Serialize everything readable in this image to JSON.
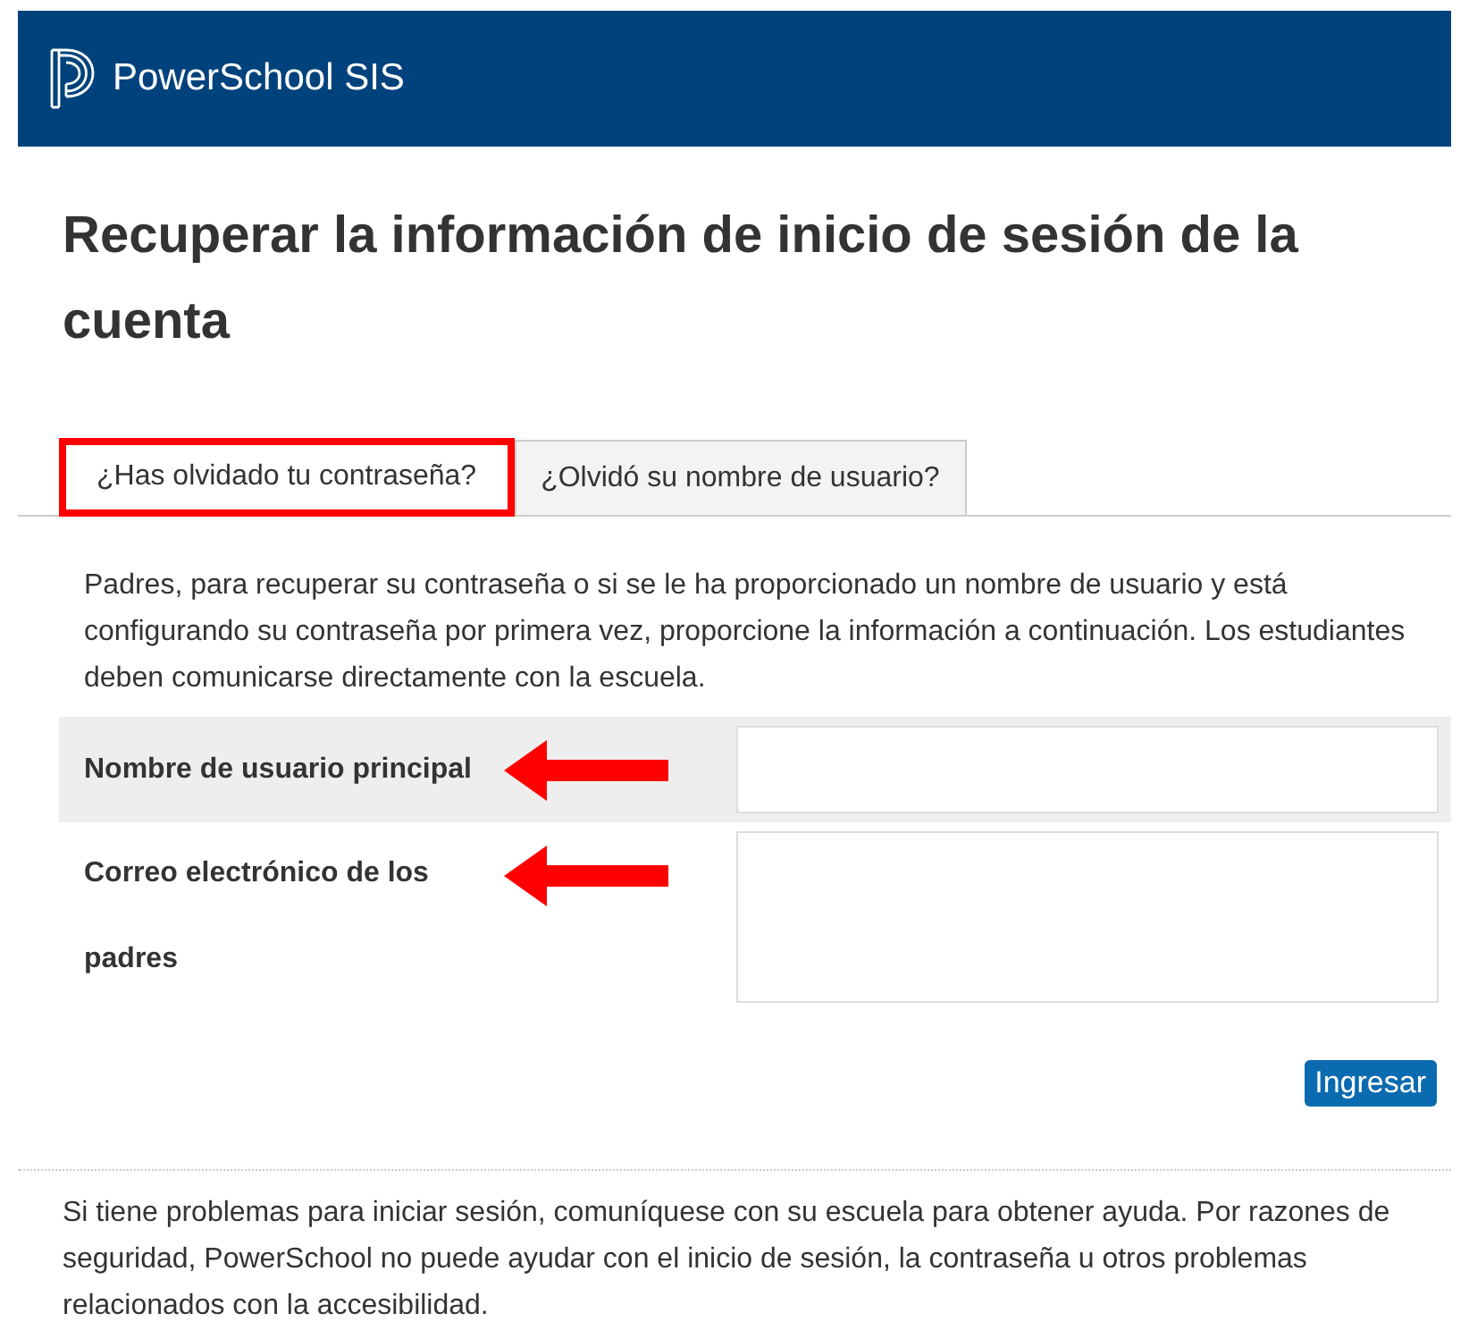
{
  "header": {
    "brand": "PowerSchool SIS"
  },
  "title": "Recuperar la información de inicio de sesión de la cuenta",
  "tabs": [
    {
      "label": "¿Has olvidado tu contraseña?",
      "selected": true,
      "highlighted": true
    },
    {
      "label": "¿Olvidó su nombre de usuario?",
      "selected": false,
      "highlighted": false
    }
  ],
  "intro": "Padres, para recuperar su contraseña o si se le ha proporcionado un nombre de usuario y está configurando su contraseña por primera vez, proporcione la información a continuación. Los estudiantes deben comunicarse directamente con la escuela.",
  "fields": [
    {
      "label": "Nombre de usuario principal",
      "kind": "input",
      "arrow": true
    },
    {
      "label": "Correo electrónico de los padres",
      "kind": "textarea",
      "arrow": true
    }
  ],
  "submit": "Ingresar",
  "footer": "Si tiene problemas para iniciar sesión, comuníquese con su escuela para obtener ayuda. Por razones de seguridad, PowerSchool no puede ayudar con el inicio de sesión, la contraseña u otros problemas relacionados con la accesibilidad."
}
